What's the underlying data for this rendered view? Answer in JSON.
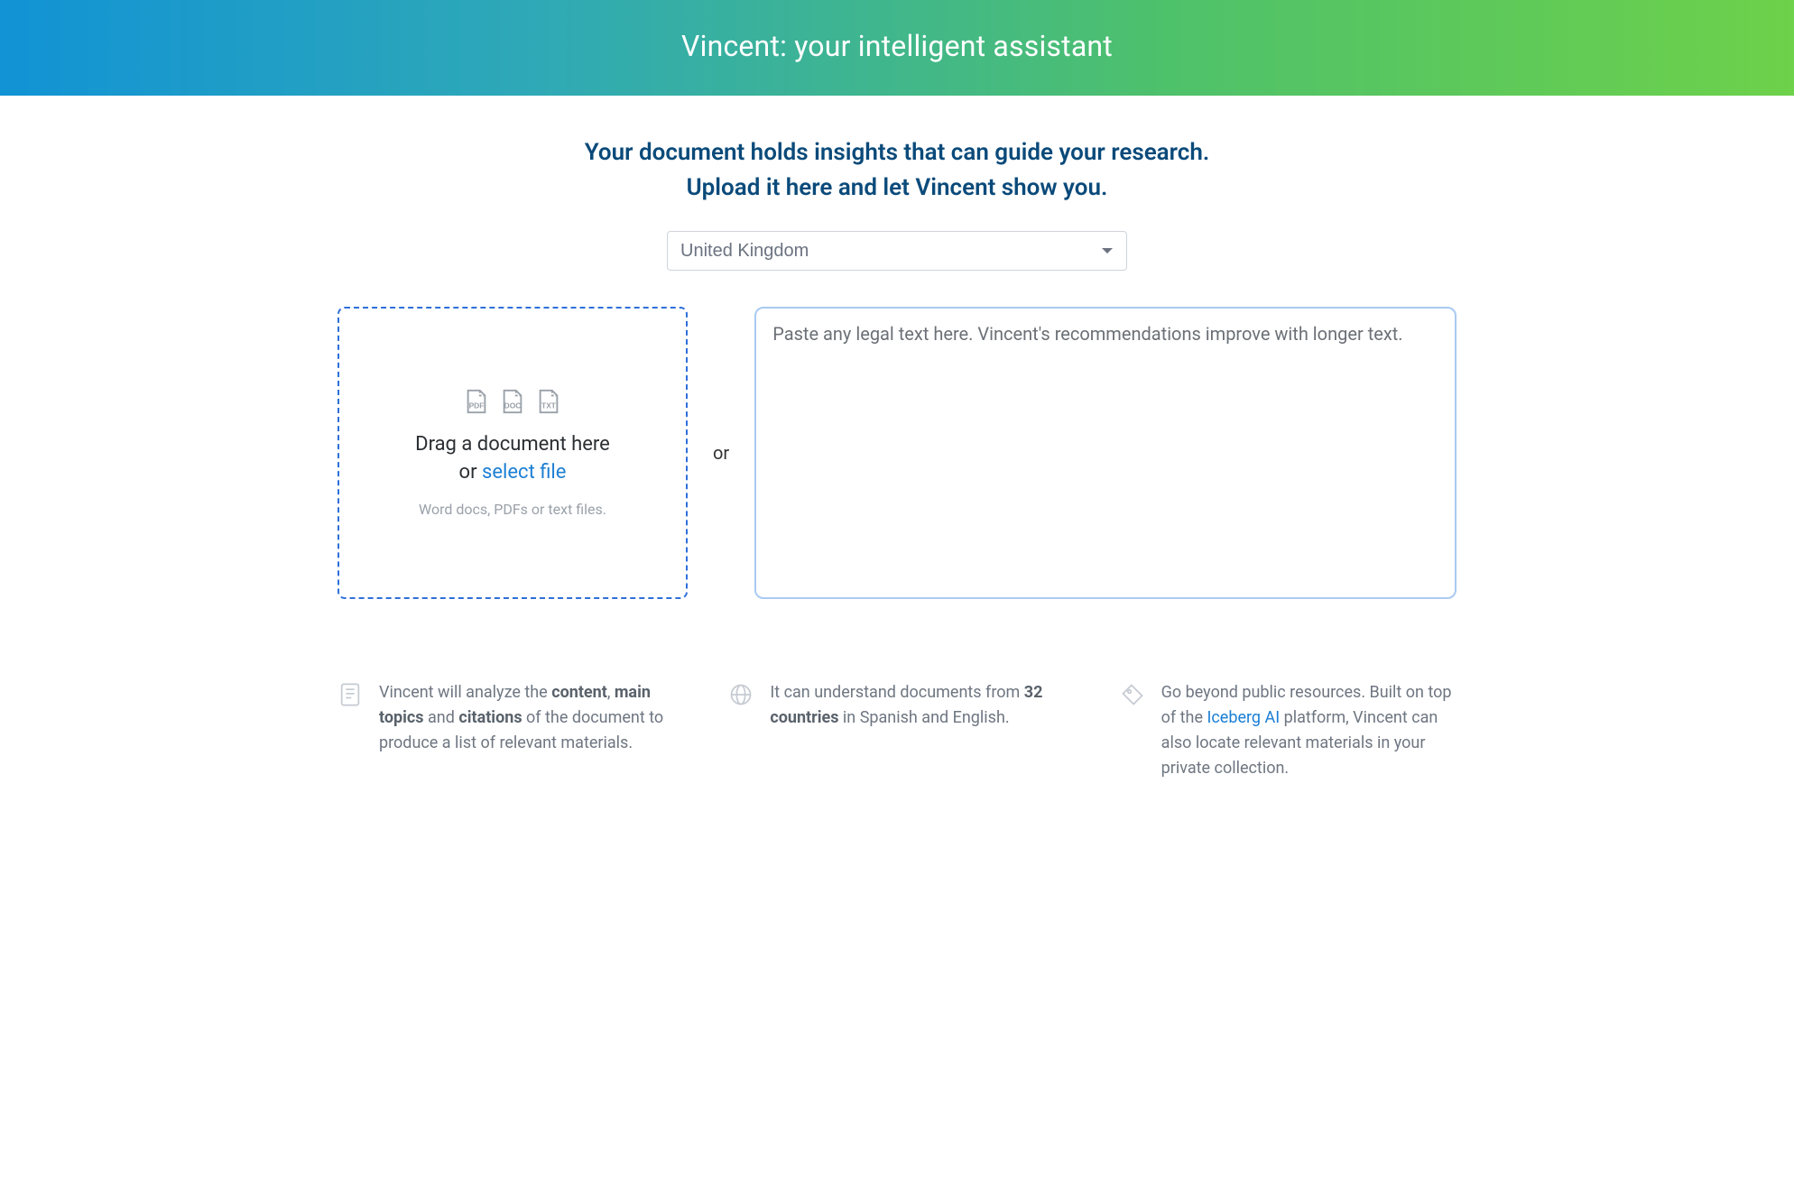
{
  "header": {
    "title": "Vincent: your intelligent assistant"
  },
  "intro": {
    "line1": "Your document holds insights that can guide your research.",
    "line2": "Upload it here and let Vincent show you."
  },
  "region": {
    "selected": "United Kingdom"
  },
  "dropzone": {
    "icon_labels": {
      "pdf": "PDF",
      "doc": "DOC",
      "txt": "TXT"
    },
    "drag_text_line1": "Drag a document here",
    "drag_text_or": "or ",
    "select_file_label": "select file",
    "hint": "Word docs, PDFs or text files."
  },
  "divider": {
    "or_label": "or"
  },
  "textarea": {
    "placeholder": "Paste any legal text here. Vincent's recommendations improve with longer text."
  },
  "features": [
    {
      "icon": "document-icon",
      "parts": [
        {
          "t": "Vincent will analyze the "
        },
        {
          "t": "content",
          "b": true
        },
        {
          "t": ", "
        },
        {
          "t": "main topics",
          "b": true
        },
        {
          "t": " and "
        },
        {
          "t": "citations",
          "b": true
        },
        {
          "t": " of the document to produce a list of relevant materials."
        }
      ]
    },
    {
      "icon": "globe-icon",
      "parts": [
        {
          "t": "It can understand documents from "
        },
        {
          "t": "32 countries",
          "b": true
        },
        {
          "t": " in Spanish and English."
        }
      ]
    },
    {
      "icon": "tag-icon",
      "parts": [
        {
          "t": "Go beyond public resources. Built on top of the "
        },
        {
          "t": "Iceberg AI",
          "link": true
        },
        {
          "t": " platform, Vincent can also locate relevant materials in your private collection."
        }
      ]
    }
  ]
}
